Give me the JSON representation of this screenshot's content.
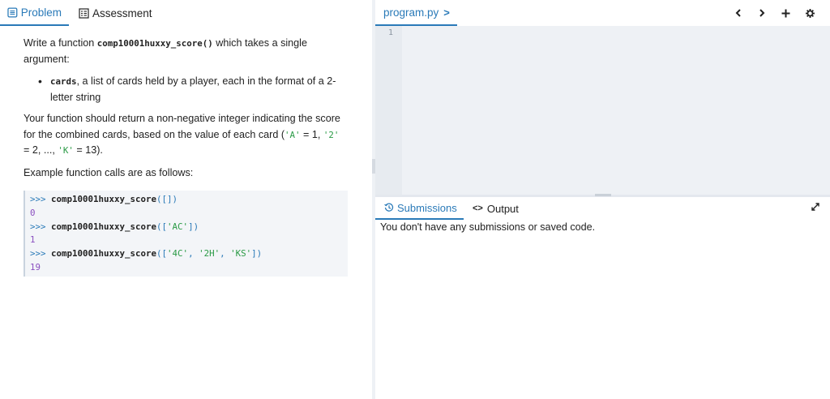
{
  "left_tabs": {
    "problem": "Problem",
    "assessment": "Assessment"
  },
  "problem": {
    "p1_prefix": "Write a function ",
    "function_name": "comp10001huxxy_score()",
    "p1_suffix": " which takes a single argument:",
    "bullet_code": "cards",
    "bullet_text": ", a list of cards held by a player, each in the format of a 2-letter string",
    "p2_text1": "Your function should return a non-negative integer indicating the score for the combined cards, based on the value of each card (",
    "p2_A": "'A'",
    "p2_eq1": " = 1, ",
    "p2_2": "'2'",
    "p2_eq2": " = 2, ..., ",
    "p2_K": "'K'",
    "p2_eq3": " = 13).",
    "p3": "Example function calls are as follows:"
  },
  "examples": [
    {
      "prompt": ">>> ",
      "fn": "comp10001huxxy_score",
      "open": "([",
      "args": [],
      "close": "])",
      "output": "0"
    },
    {
      "prompt": ">>> ",
      "fn": "comp10001huxxy_score",
      "open": "([",
      "args": [
        "'AC'"
      ],
      "close": "])",
      "output": "1"
    },
    {
      "prompt": ">>> ",
      "fn": "comp10001huxxy_score",
      "open": "([",
      "args": [
        "'4C'",
        "'2H'",
        "'KS'"
      ],
      "close": "])",
      "output": "19"
    }
  ],
  "editor": {
    "file_tab": "program.py",
    "file_chevron": ">",
    "line_number": "1",
    "icons": [
      "chevron-left-icon",
      "chevron-right-icon",
      "plus-icon",
      "gear-icon"
    ]
  },
  "bottom": {
    "submissions_tab": "Submissions",
    "output_tab": "Output",
    "output_symbol": "<>",
    "message": "You don't have any submissions or saved code."
  },
  "colors": {
    "accent": "#2a7ab8",
    "string": "#2a9a45",
    "output": "#8a4fc0",
    "editor_bg": "#eef1f5"
  }
}
